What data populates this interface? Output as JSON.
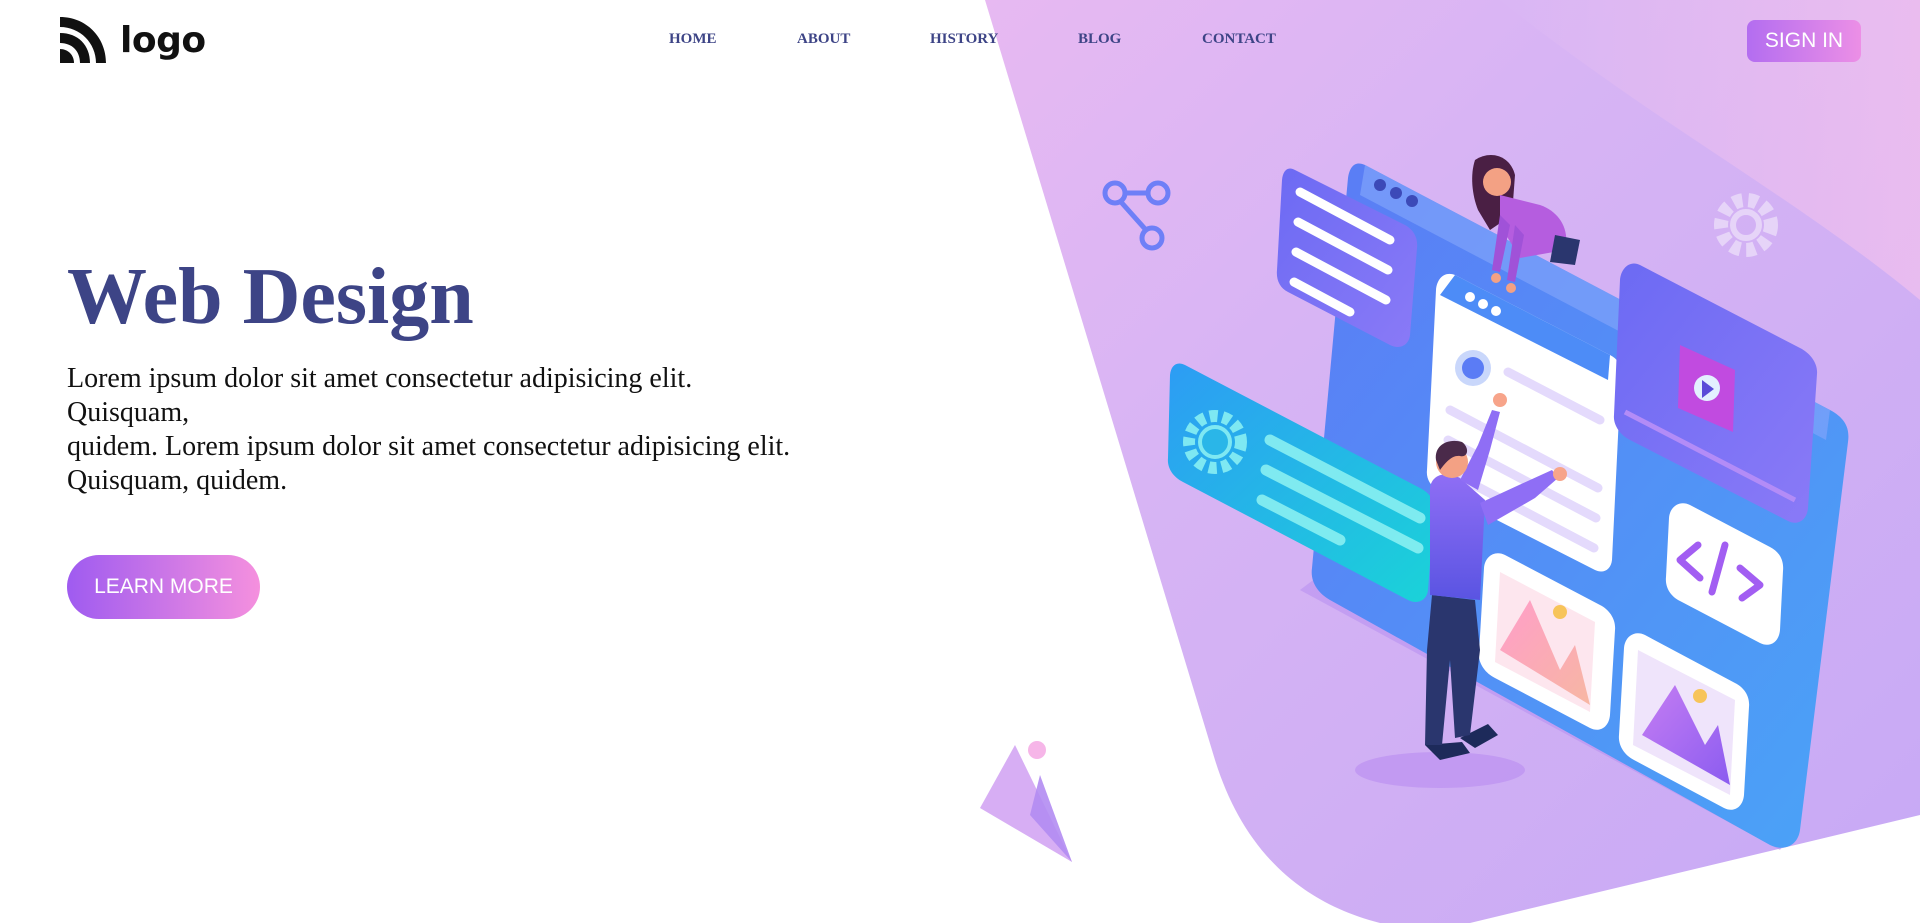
{
  "header": {
    "logo_text": "logo",
    "nav": [
      {
        "label": "HOME"
      },
      {
        "label": "ABOUT"
      },
      {
        "label": "HISTORY"
      },
      {
        "label": "BLOG"
      },
      {
        "label": "CONTACT"
      }
    ],
    "signin_label": "SIGN IN"
  },
  "hero": {
    "title": "Web Design",
    "lines": [
      "Lorem ipsum dolor sit amet consectetur adipisicing elit.",
      "Quisquam,",
      "quidem. Lorem ipsum dolor sit amet consectetur adipisicing elit.",
      "Quisquam, quidem."
    ],
    "cta_label": "LEARN MORE"
  },
  "icons": {
    "logo": "logo-mark-icon",
    "share": "share-icon",
    "gear": "gear-icon",
    "code": "code-icon",
    "image": "image-icon",
    "play": "play-icon"
  },
  "colors": {
    "accent_navy": "#3d4486",
    "gradient_purple": "#b36df0",
    "gradient_pink": "#ec8fe6",
    "bg_lavender": "#d3b1f3"
  }
}
